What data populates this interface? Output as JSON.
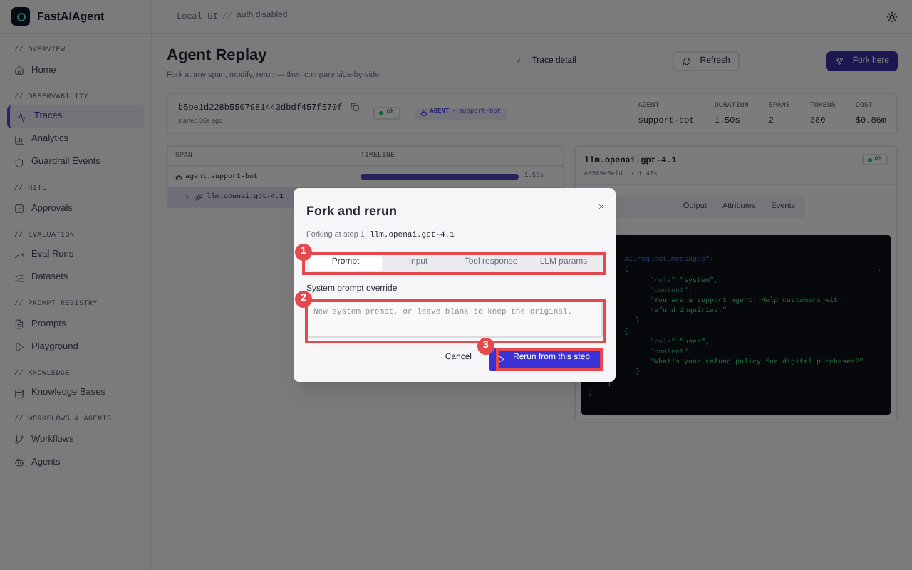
{
  "brand": "FastAIAgent",
  "sidebar": {
    "sections": [
      {
        "title": "// OVERVIEW",
        "items": [
          {
            "label": "Home",
            "selected": false
          }
        ]
      },
      {
        "title": "// OBSERVABILITY",
        "items": [
          {
            "label": "Traces",
            "selected": true
          },
          {
            "label": "Analytics",
            "selected": false
          },
          {
            "label": "Guardrail Events",
            "selected": false
          }
        ]
      },
      {
        "title": "// HITL",
        "items": [
          {
            "label": "Approvals",
            "selected": false
          }
        ]
      },
      {
        "title": "// EVALUATION",
        "items": [
          {
            "label": "Eval Runs",
            "selected": false
          },
          {
            "label": "Datasets",
            "selected": false
          }
        ]
      },
      {
        "title": "// PROMPT REGISTRY",
        "items": [
          {
            "label": "Prompts",
            "selected": false
          },
          {
            "label": "Playground",
            "selected": false
          }
        ]
      },
      {
        "title": "// KNOWLEDGE",
        "items": [
          {
            "label": "Knowledge Bases",
            "selected": false
          }
        ]
      },
      {
        "title": "// WORKFLOWS & AGENTS",
        "items": [
          {
            "label": "Workflows",
            "selected": false
          },
          {
            "label": "Agents",
            "selected": false
          }
        ]
      }
    ]
  },
  "topbar": {
    "env": "Local UI",
    "separator": "//",
    "auth": "auth disabled"
  },
  "header": {
    "title": "Agent Replay",
    "subtitle": "Fork at any span, modify, rerun — then compare side-by-side.",
    "buttons": [
      {
        "kind": "back",
        "label": "Trace detail"
      },
      {
        "kind": "refresh",
        "label": "Refresh"
      },
      {
        "kind": "primary",
        "label": "Fork here"
      }
    ]
  },
  "trace": {
    "id": "b5be1d228b5507981443dbdf457f570f",
    "started": "started 36s ago",
    "status": "ok",
    "agent_badge": {
      "kind": "AGENT",
      "separator": "·",
      "name": "support-bot"
    },
    "stats": [
      {
        "label": "AGENT",
        "value": "support-bot"
      },
      {
        "label": "DURATION",
        "value": "1.50s"
      },
      {
        "label": "SPANS",
        "value": "2"
      },
      {
        "label": "TOKENS",
        "value": "380"
      },
      {
        "label": "COST",
        "value": "$0.86m"
      }
    ]
  },
  "spans": {
    "columns": [
      "SPAN",
      "TIMELINE"
    ],
    "rows": [
      {
        "name": "agent.support-bot",
        "selected": false,
        "level": 1,
        "duration": "1.50s",
        "children": [
          {
            "name": "llm.openai.gpt-4.1",
            "selected": true
          }
        ]
      }
    ]
  },
  "detail": {
    "name": "llm.openai.gpt-4.1",
    "status": "ok",
    "meta": "e9589e5efd… · 1.47s",
    "tabs": [
      {
        "label": "Output",
        "selected": false
      },
      {
        "label": "Attributes",
        "selected": false
      },
      {
        "label": "Events",
        "selected": false
      }
    ],
    "code": [
      {
        "kind": "root",
        "key": "ai.request.messages\":"
      },
      {
        "kind": "open",
        "value": "{",
        "tail": ","
      },
      {
        "kind": "field",
        "key": "\"role\":",
        "value": "\"system\","
      },
      {
        "kind": "field",
        "key": "\"content\":"
      },
      {
        "kind": "field",
        "value": "\"You are a support agent. Help customers with"
      },
      {
        "kind": "field",
        "value": "refund inquiries.\""
      },
      {
        "kind": "close",
        "value": "}"
      },
      {
        "kind": "open",
        "value": "{"
      },
      {
        "kind": "field",
        "key": "\"role\":",
        "value": "\"user\","
      },
      {
        "kind": "field",
        "key": "\"content\":"
      },
      {
        "kind": "field",
        "value": "\"What's your refund policy for digital purchases?\""
      },
      {
        "kind": "close",
        "value": "}"
      },
      {
        "kind": "end",
        "value": "]"
      },
      {
        "kind": "final",
        "value": "}"
      }
    ]
  },
  "dialog": {
    "title": "Fork and rerun",
    "subtitle": "Forking at step 1:",
    "step": "llm.openai.gpt-4.1",
    "tabs": [
      {
        "label": "Prompt",
        "selected": true
      },
      {
        "label": "Input",
        "selected": false
      },
      {
        "label": "Tool response",
        "selected": false
      },
      {
        "label": "LLM params",
        "selected": false
      }
    ],
    "field_label": "System prompt override",
    "placeholder": "New system prompt, or leave blank to keep the original.",
    "buttons": [
      {
        "kind": "cancel",
        "label": "Cancel"
      },
      {
        "kind": "primary",
        "label": "Rerun from this step"
      }
    ]
  },
  "annotations": [
    {
      "label": "1"
    },
    {
      "label": "2"
    },
    {
      "label": "3"
    }
  ]
}
